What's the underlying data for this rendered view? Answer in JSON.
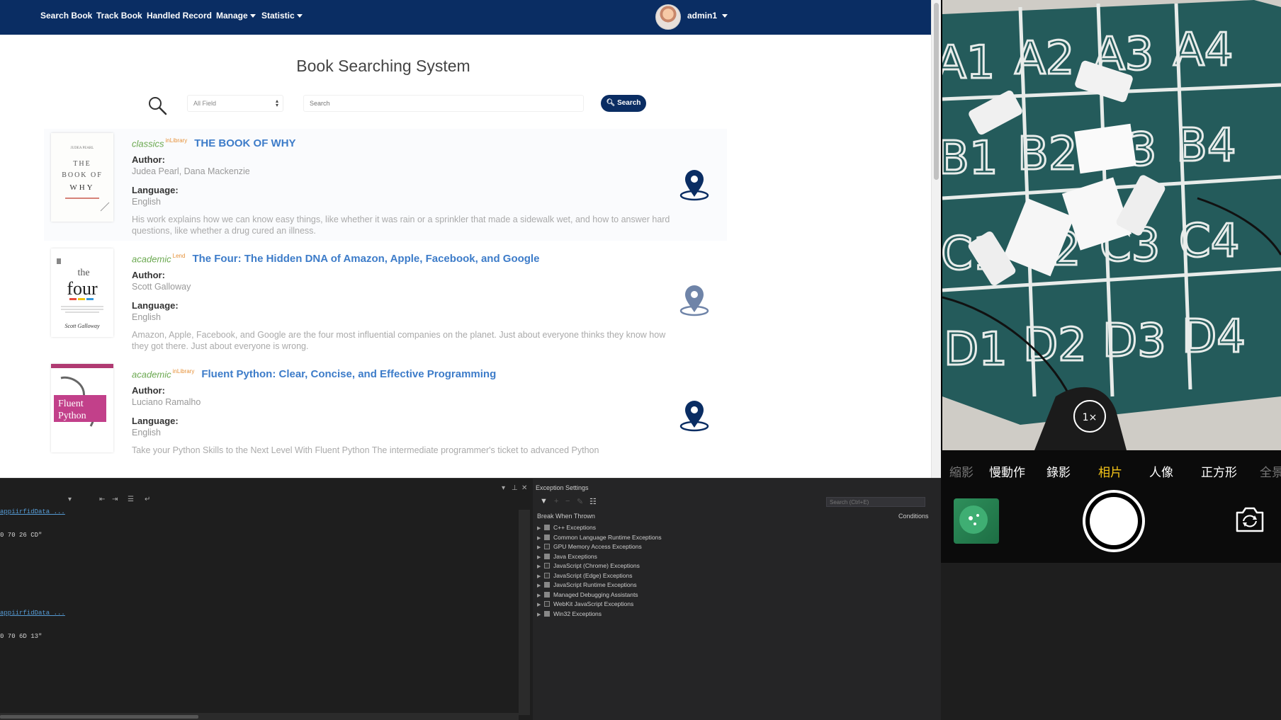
{
  "navbar": {
    "search_book": "Search Book",
    "track_book": "Track Book",
    "handled_record": "Handled Record",
    "manage": "Manage",
    "statistic": "Statistic",
    "user": "admin1"
  },
  "page": {
    "title": "Book Searching System",
    "field_select": "All Field",
    "search_placeholder": "Search",
    "search_button": "Search"
  },
  "books": [
    {
      "category": "classics",
      "status": "inLibrary",
      "title": "THE BOOK OF WHY",
      "author_label": "Author:",
      "author": "Judea Pearl, Dana Mackenzie",
      "language_label": "Language:",
      "language": "English",
      "description": "His work explains how we can know easy things, like whether it was rain or a sprinkler that made a sidewalk wet, and how to answer hard questions, like whether a drug cured an illness.",
      "cover": {
        "l1": "JUDEA PEARL",
        "l2": "THE",
        "l3": "BOOK OF",
        "l4": "WHY"
      }
    },
    {
      "category": "academic",
      "status": "Lend",
      "title": "The Four: The Hidden DNA of Amazon, Apple, Facebook, and Google",
      "author_label": "Author:",
      "author": "Scott Galloway",
      "language_label": "Language:",
      "language": "English",
      "description": "Amazon, Apple, Facebook, and Google are the four most influential companies on the planet. Just about everyone thinks they know how they got there. Just about everyone is wrong.",
      "cover": {
        "l1": "the",
        "l2": "four",
        "l3": "Scott Galloway"
      }
    },
    {
      "category": "academic",
      "status": "inLibrary",
      "title": "Fluent Python: Clear, Concise, and Effective Programming",
      "author_label": "Author:",
      "author": "Luciano Ramalho",
      "language_label": "Language:",
      "language": "English",
      "description": "Take your Python Skills to the Next Level With Fluent Python The intermediate programmer's ticket to advanced Python",
      "cover": {
        "l1": "Fluent",
        "l2": "Python"
      }
    }
  ],
  "camera": {
    "modes": [
      "縮影",
      "慢動作",
      "錄影",
      "相片",
      "人像",
      "正方形",
      "全景"
    ],
    "active_mode": "相片",
    "zoom": "1×",
    "grid_labels": [
      "A1",
      "A2",
      "A3",
      "A4",
      "B1",
      "B2",
      "B3",
      "B4",
      "C1",
      "C2",
      "C3",
      "C4",
      "D1",
      "D2",
      "D3",
      "D4"
    ]
  },
  "ide": {
    "output_lines": [
      "appiirfidData ...",
      "0 70 26 CD\"",
      "appiirfidData ...",
      "0 70 6D 13\""
    ],
    "exception_title": "Exception Settings",
    "search_placeholder": "Search (Ctrl+E)",
    "column_break": "Break When Thrown",
    "column_conditions": "Conditions",
    "exceptions": [
      {
        "name": "C++ Exceptions",
        "checked": true
      },
      {
        "name": "Common Language Runtime Exceptions",
        "checked": true
      },
      {
        "name": "GPU Memory Access Exceptions",
        "checked": false
      },
      {
        "name": "Java Exceptions",
        "checked": true
      },
      {
        "name": "JavaScript (Chrome) Exceptions",
        "checked": false
      },
      {
        "name": "JavaScript (Edge) Exceptions",
        "checked": false
      },
      {
        "name": "JavaScript Runtime Exceptions",
        "checked": true
      },
      {
        "name": "Managed Debugging Assistants",
        "checked": true
      },
      {
        "name": "WebKit JavaScript Exceptions",
        "checked": false
      },
      {
        "name": "Win32 Exceptions",
        "checked": true
      }
    ]
  },
  "colors": {
    "navbar": "#0a2d63",
    "category": "#6aa84f",
    "status": "#e69138",
    "title_link": "#3d7cc9",
    "mat": "#245b5b"
  }
}
